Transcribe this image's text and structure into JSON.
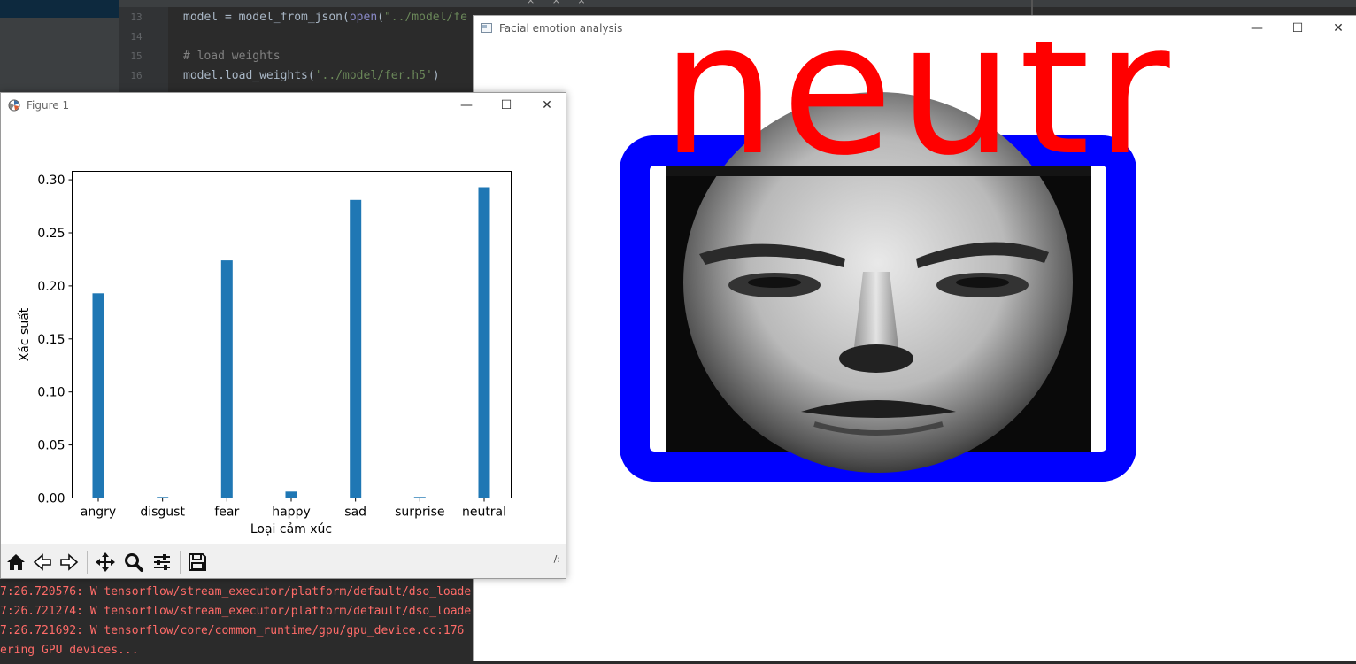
{
  "ide": {
    "code_lines": [
      {
        "n": "13",
        "parts": [
          [
            "",
            "model = model_from_json("
          ],
          [
            "builtin",
            "open"
          ],
          [
            "",
            "("
          ],
          [
            "str",
            "\"../model/fe"
          ]
        ]
      },
      {
        "n": "14",
        "parts": [
          [
            "",
            ""
          ]
        ]
      },
      {
        "n": "15",
        "parts": [
          [
            "comment",
            "# load weights"
          ]
        ]
      },
      {
        "n": "16",
        "parts": [
          [
            "",
            "model.load_weights("
          ],
          [
            "str",
            "'../model/fer.h5'"
          ],
          [
            "",
            ")"
          ]
        ]
      }
    ],
    "console_lines": [
      "7:26.720576: W tensorflow/stream_executor/platform/default/dso_loade",
      "7:26.721274: W tensorflow/stream_executor/platform/default/dso_loade",
      "7:26.721692: W tensorflow/core/common_runtime/gpu/gpu_device.cc:176",
      "ering GPU devices..."
    ]
  },
  "emotion_window": {
    "title": "Facial emotion analysis",
    "prediction_text": "neutr",
    "text_color": "#ff0000",
    "box_color": "#0000ff"
  },
  "figure_window": {
    "title": "Figure 1",
    "coord_readout": "/:"
  },
  "chart_data": {
    "type": "bar",
    "categories": [
      "angry",
      "disgust",
      "fear",
      "happy",
      "sad",
      "surprise",
      "neutral"
    ],
    "values": [
      0.193,
      0.001,
      0.224,
      0.006,
      0.281,
      0.001,
      0.293
    ],
    "xlabel": "Loại cảm xúc",
    "ylabel": "Xác suất",
    "ylim": [
      0,
      0.308
    ],
    "yticks": [
      0.0,
      0.05,
      0.1,
      0.15,
      0.2,
      0.25,
      0.3
    ],
    "ytick_labels": [
      "0.00",
      "0.05",
      "0.10",
      "0.15",
      "0.20",
      "0.25",
      "0.30"
    ],
    "bar_color": "#1f77b4",
    "grid": false
  }
}
